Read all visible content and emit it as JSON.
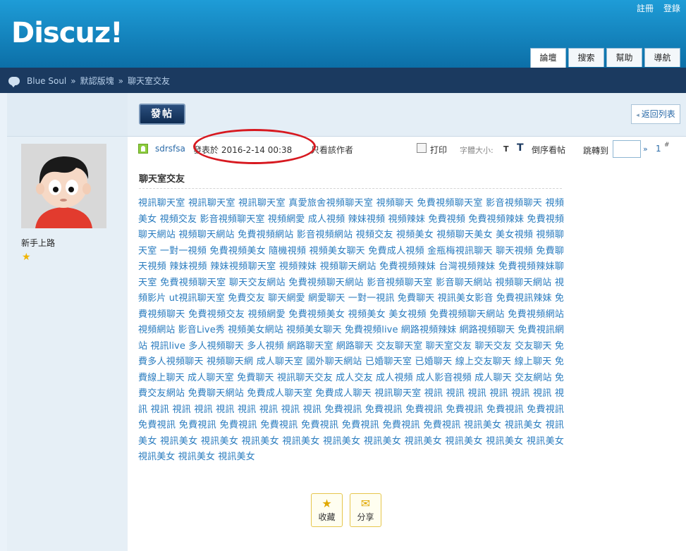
{
  "header": {
    "logo": "Discuz!",
    "top_links": [
      "註冊",
      "登錄"
    ],
    "tabs": [
      {
        "label": "論壇",
        "active": true
      },
      {
        "label": "搜索",
        "active": false
      },
      {
        "label": "幫助",
        "active": false
      },
      {
        "label": "導航",
        "active": false
      }
    ]
  },
  "breadcrumb": {
    "items": [
      "Blue Soul",
      "默認版塊",
      "聊天室交友"
    ],
    "separator": "»"
  },
  "toolbar": {
    "post_button": "發帖",
    "back_button": "返回列表"
  },
  "author": {
    "username": "sdrsfsa",
    "rank": "新手上路"
  },
  "post": {
    "posted_at": "發表於 2016-2-14 00:38",
    "only_author": "只看該作者",
    "print": "打印",
    "font_size_label": "字體大小:",
    "font_size_t": "T",
    "reverse_icon": "T",
    "reverse": "倒序看帖",
    "jump_to": "跳轉到",
    "jump_go": "»",
    "floor": "1",
    "floor_sup": "#",
    "title": "聊天室交友",
    "body": "視訊聊天室 視訊聊天室 視訊聊天室 真愛旅舍視頻聊天室 視頻聊天 免費視頻聊天室 影音視頻聊天 視頻美女 視頻交友 影音視頻聊天室 視頻網愛 成人視頻 辣妹視頻 視頻辣妹 免費視頻 免費視頻辣妹 免費視頻聊天網站 視頻聊天網站 免費視頻網站 影音視頻網站 視頻交友 視頻美女 視頻聊天美女 美女視頻 視頻聊天室 一對一視頻 免費視頻美女 隨機視頻 視頻美女聊天 免費成人視頻 金瓶梅視訊聊天 聊天視頻 免費聊天視頻 辣妹視頻 辣妹視頻聊天室 視頻辣妹 視頻聊天網站 免費視頻辣妹 台灣視頻辣妹 免費視頻辣妹聊天室 免費視頻聊天室 聊天交友網站 免費視頻聊天網站 影音視頻聊天室 影音聊天網站 視頻聊天網站 視頻影片 ut視訊聊天室 免費交友 聊天網愛 網愛聊天 一對一視訊 免費聊天 視訊美女影音 免費視訊辣妹 免費視頻聊天 免費視頻交友 視頻網愛 免費視頻美女 視頻美女 美女視頻 免費視頻聊天網站 免費視頻網站 視頻網站 影音Live秀 視頻美女網站 視頻美女聊天 免費視頻live 網路視頻辣妹 網路視頻聊天 免費視訊網站 視訊live 多人視頻聊天 多人視頻 網路聊天室 網路聊天 交友聊天室 聊天室交友 聊天交友 交友聊天 免費多人視頻聊天 視頻聊天網 成人聊天室 國外聊天網站 已婚聊天室 已婚聊天 線上交友聊天 線上聊天 免費線上聊天 成人聊天室 免費聊天 視訊聊天交友 成人交友 成人視頻 成人影音視頻 成人聊天 交友網站 免費交友網站 免費聊天網站 免費成人聊天室 免費成人聊天 視訊聊天室 視訊  視訊 視訊 視訊 視訊 視訊 視訊 視訊 視訊 視訊 視訊 視訊 視訊 視訊 視訊 免費視訊 免費視訊 免費視訊 免費視訊 免費視訊 免費視訊 免費視訊 免費視訊 免費視訊 免費視訊 免費視訊 免費視訊 免費視訊 免費視訊 視訊美女 視訊美女 視訊美女 視訊美女 視訊美女 視訊美女 視訊美女 視訊美女 視訊美女 視訊美女 視訊美女 視訊美女 視訊美女 視訊美女 視訊美女 視訊美女"
  },
  "actions": {
    "favorite": "收藏",
    "share": "分享"
  }
}
